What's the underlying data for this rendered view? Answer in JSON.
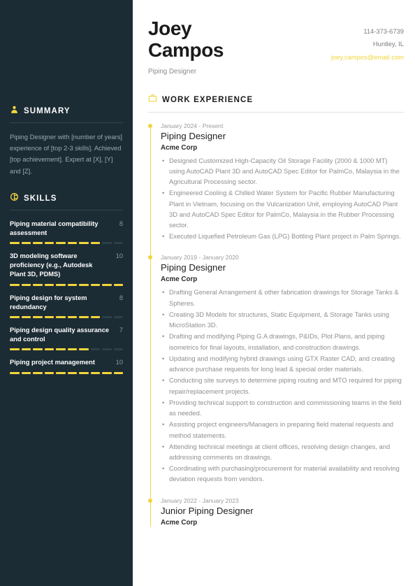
{
  "theme": {
    "sidebar_bg": "#1c2c35",
    "accent": "#f2d53c",
    "page_bg": "#ffffff"
  },
  "header": {
    "first_name": "Joey",
    "last_name": "Campos",
    "role": "Piping Designer",
    "contact": {
      "phone": "114-373-6739",
      "location": "Huntley, IL",
      "email": "joey.campos@email.com"
    }
  },
  "sidebar": {
    "summary": {
      "icon": "user-icon",
      "title": "SUMMARY",
      "text": "Piping Designer with [number of years] experience of [top 2-3 skills]. Achieved [top achievement]. Expert at [X], [Y] and [Z]."
    },
    "skills": {
      "icon": "target-icon",
      "title": "SKILLS",
      "max": 10,
      "items": [
        {
          "name": "Piping material compatibility assessment",
          "value": 8
        },
        {
          "name": "3D modeling software proficiency (e.g., Autodesk Plant 3D, PDMS)",
          "value": 10
        },
        {
          "name": "Piping design for system redundancy",
          "value": 8
        },
        {
          "name": "Piping design quality assurance and control",
          "value": 7
        },
        {
          "name": "Piping project management",
          "value": 10
        }
      ]
    }
  },
  "main": {
    "work_experience": {
      "icon": "briefcase-icon",
      "title": "WORK EXPERIENCE",
      "jobs": [
        {
          "date": "January 2024 - Present",
          "title": "Piping Designer",
          "company": "Acme Corp",
          "bullets": [
            "Designed Customized High-Capacity Oil Storage Facility (2000 & 1000 MT) using AutoCAD Plant 3D and AutoCAD Spec Editor for PalmCo, Malaysia in the Agricultural Processing sector.",
            "Engineered Cooling & Chilled Water System for Pacific Rubber Manufacturing Plant in Vietnam, focusing on the Vulcanization Unit, employing AutoCAD Plant 3D and AutoCAD Spec Editor for PalmCo, Malaysia in the Rubber Processing sector.",
            "Executed Liquefied Petroleum Gas (LPG) Bottling Plant project in Palm Springs."
          ]
        },
        {
          "date": "January 2019 - January 2020",
          "title": "Piping Designer",
          "company": "Acme Corp",
          "bullets": [
            "Drafting General Arrangement & other fabrication drawings for Storage Tanks & Spheres.",
            "Creating 3D Models for structures, Static Equipment, & Storage Tanks using MicroStation 3D.",
            "Drafting and modifying Piping G.A drawings, P&IDs, Plot Plans, and piping isometrics for final layouts, installation, and construction drawings.",
            "Updating and modifying hybrid drawings using GTX Raster CAD, and creating advance purchase requests for long lead & special order materials.",
            "Conducting site surveys to determine piping routing and MTO required for piping repair/replacement projects.",
            "Providing technical support to construction and commissioning teams in the field as needed.",
            "Assisting project engineers/Managers in preparing field material requests and method statements.",
            "Attending technical meetings at client offices, resolving design changes, and addressing comments on drawings.",
            "Coordinating with purchasing/procurement for material availability and resolving deviation requests from vendors."
          ]
        },
        {
          "date": "January 2022 - January 2023",
          "title": "Junior Piping Designer",
          "company": "Acme Corp",
          "bullets": []
        }
      ]
    }
  }
}
